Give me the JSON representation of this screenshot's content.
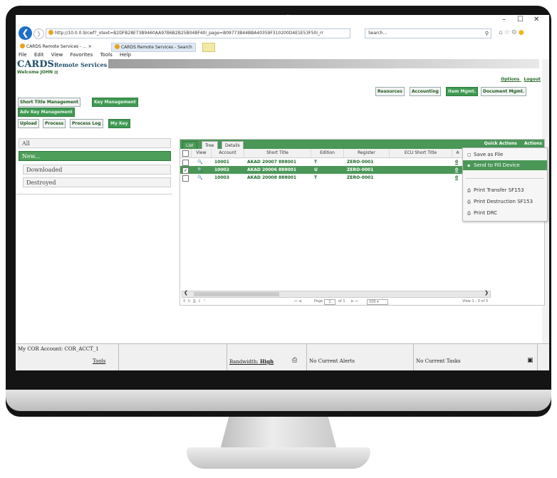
{
  "browser": {
    "address": "http://10.0.0.9/cwf?_otext=B2DFB28E73B9460AA97B6B2B25B04BF40i_page=B09773B44BBA40359F310200D4E1E53F50i_rr",
    "search_placeholder": "Search...",
    "tabs": [
      {
        "label": "CARDS Remote Services - ..."
      },
      {
        "label": "CARDS Remote Services - Search"
      }
    ],
    "menu": [
      "File",
      "Edit",
      "View",
      "Favorites",
      "Tools",
      "Help"
    ]
  },
  "app": {
    "logo_main": "CARDS",
    "logo_sub": "Remote Services",
    "welcome": "Welcome JOHN",
    "links": [
      "Options",
      "Logout"
    ],
    "top_tabs": [
      "Resources",
      "Accounting",
      "Item Mgmt.",
      "Document Mgmt."
    ],
    "row1_tabs": [
      "Short Title Management",
      "Key Management"
    ],
    "row2_tabs": [
      "Adv Key Management"
    ],
    "row3_tabs": [
      "Upload",
      "Process",
      "Process Log",
      "My Key"
    ]
  },
  "leftnav": [
    "All",
    "New...",
    "Downloaded",
    "Destroyed"
  ],
  "grid": {
    "tabs": [
      "List",
      "Tree",
      "Details"
    ],
    "quick_actions": "Quick Actions",
    "actions": "Actions",
    "columns": [
      "View",
      "Account",
      "Short Title",
      "Edition",
      "Register",
      "ECU Short Title",
      "A"
    ],
    "rows": [
      {
        "checked": "",
        "account": "10001",
        "title": "AKAD 20007 888001",
        "edition": "T",
        "register": "ZERO-0001",
        "ecu": "",
        "a": "0"
      },
      {
        "checked": "✓",
        "account": "10002",
        "title": "AKAD 20006 888001",
        "edition": "U",
        "register": "ZERO-0001",
        "ecu": "",
        "a": "0"
      },
      {
        "checked": "",
        "account": "10003",
        "title": "AKAD 20008 888001",
        "edition": "T",
        "register": "ZERO-0001",
        "ecu": "",
        "a": "0"
      }
    ],
    "pager_page_label": "Page",
    "pager_page": "1",
    "pager_of": "of 1",
    "pager_size": "100",
    "pager_summary": "View 1 - 3 of 3"
  },
  "quick_menu": [
    "Save as File",
    "Send to Fill Device",
    "Print Transfer SF153",
    "Print Destruction SF153",
    "Print DRC"
  ],
  "status": {
    "cor_account": "My COR Account: COR_ACCT_1",
    "tools": "Tools",
    "bandwidth_label": "Bandwidth:",
    "bandwidth_value": "High",
    "alerts": "No Current Alerts",
    "tasks": "No Current Tasks"
  },
  "colors": {
    "accent": "#4a9757",
    "logo": "#224f6c",
    "browser_blue": "#1e6fc8"
  }
}
